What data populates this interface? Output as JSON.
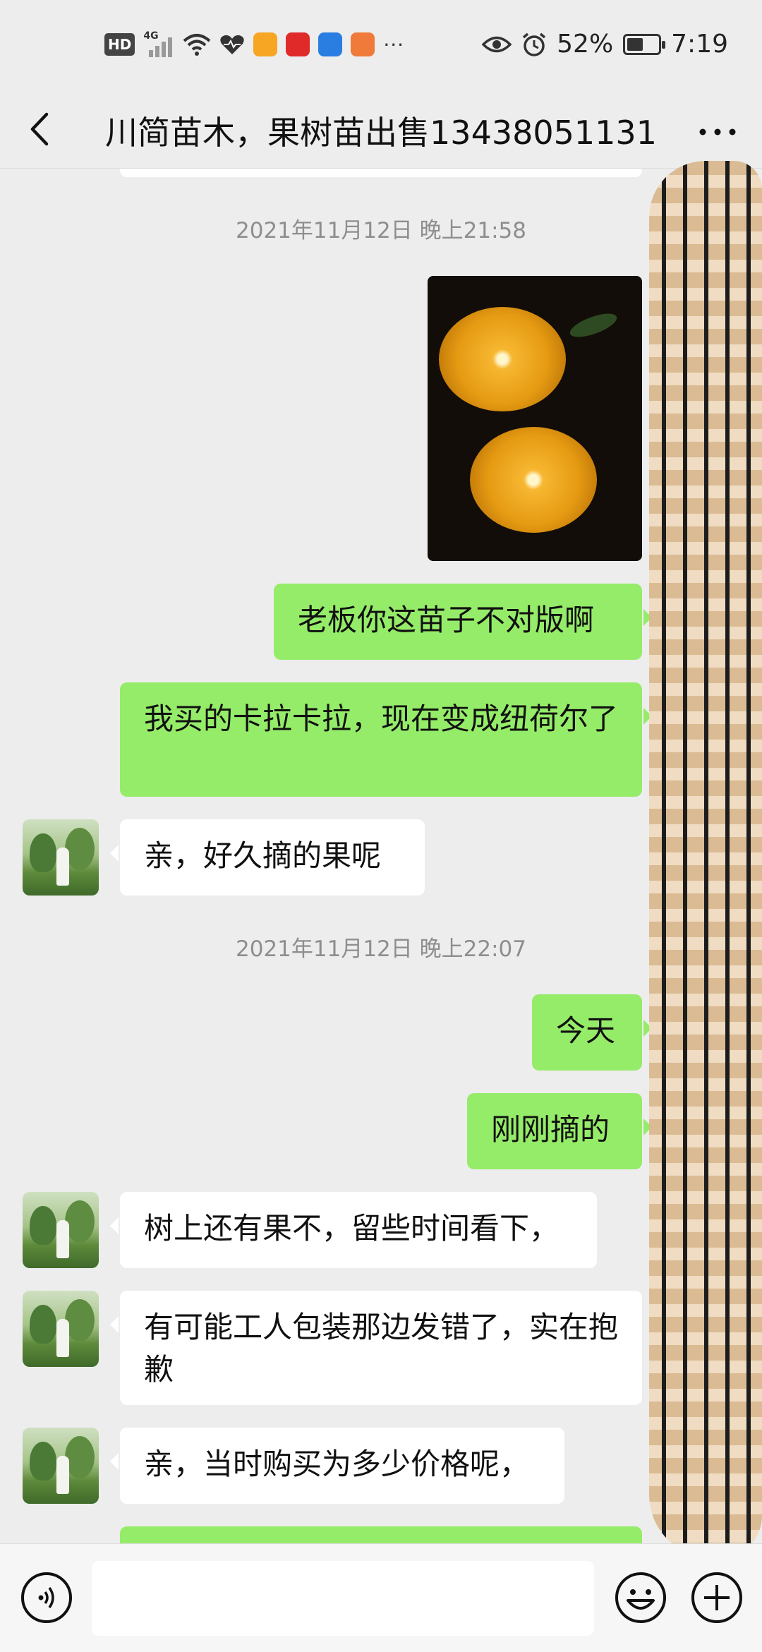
{
  "status_bar": {
    "hd": "HD",
    "network": "4G",
    "battery_percent": "52%",
    "battery_level": 0.52,
    "time": "7:19",
    "more": "···"
  },
  "nav": {
    "title": "川简苗木，果树苗出售13438051131"
  },
  "timestamps": [
    "2021年11月12日 晚上21:58",
    "2021年11月12日 晚上22:07"
  ],
  "messages": {
    "m1": "老板你这苗子不对版啊",
    "m2": "我买的卡拉卡拉，现在变成纽荷尔了",
    "m3": "亲，好久摘的果呢",
    "m4": "今天",
    "m5": "刚刚摘的",
    "m6": "树上还有果不，留些时间看下，",
    "m7": "有可能工人包装那边发错了，实在抱歉",
    "m8": "亲，当时购买为多少价格呢，"
  },
  "colors": {
    "background": "#ededed",
    "outgoing_bubble": "#95ec69",
    "incoming_bubble": "#ffffff",
    "timestamp_text": "#8e8e8e"
  },
  "icons": [
    "back-arrow-icon",
    "more-dots-icon",
    "voice-icon",
    "emoji-icon",
    "plus-icon"
  ]
}
